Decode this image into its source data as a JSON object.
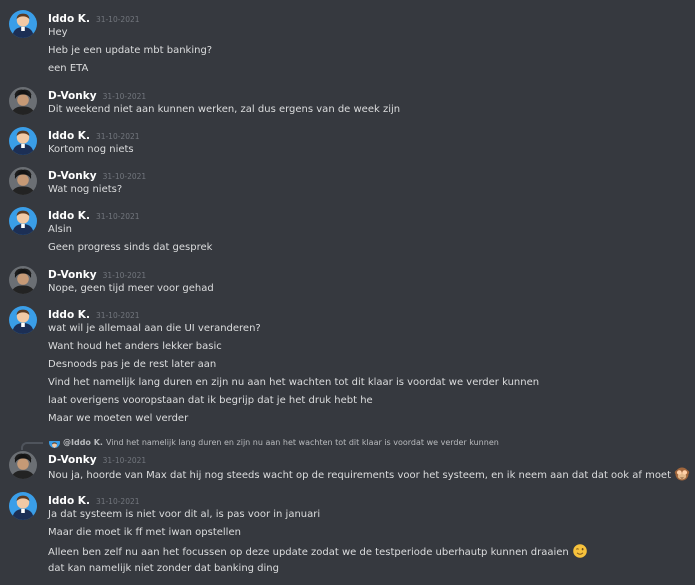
{
  "users": {
    "iddo": {
      "name": "Iddo K.",
      "reply_name": "@Iddo K."
    },
    "dvonky": {
      "name": "D-Vonky"
    }
  },
  "timestamp": "31-10-2021",
  "groups": [
    {
      "author": "Iddo K.",
      "time": "31-10-2021",
      "lines": [
        "Hey",
        "Heb je een update mbt banking?",
        "een ETA"
      ]
    },
    {
      "author": "D-Vonky",
      "time": "31-10-2021",
      "lines": [
        "Dit weekend niet aan kunnen werken, zal dus ergens van de week zijn"
      ]
    },
    {
      "author": "Iddo K.",
      "time": "31-10-2021",
      "lines": [
        "Kortom nog niets"
      ]
    },
    {
      "author": "D-Vonky",
      "time": "31-10-2021",
      "lines": [
        "Wat nog niets?"
      ]
    },
    {
      "author": "Iddo K.",
      "time": "31-10-2021",
      "lines": [
        "Alsin",
        "Geen progress sinds dat gesprek"
      ]
    },
    {
      "author": "D-Vonky",
      "time": "31-10-2021",
      "lines": [
        "Nope, geen tijd meer voor gehad"
      ]
    },
    {
      "author": "Iddo K.",
      "time": "31-10-2021",
      "lines": [
        "wat wil je allemaal aan die UI veranderen?",
        "Want houd het anders lekker basic",
        "Desnoods pas je de rest later aan",
        "Vind het namelijk lang duren en zijn nu aan het wachten tot dit klaar is voordat we verder kunnen",
        "laat overigens vooropstaan dat ik begrijp dat je het druk hebt he",
        "Maar we moeten wel verder"
      ]
    },
    {
      "author": "D-Vonky",
      "time": "31-10-2021",
      "lines": [
        "Nou ja, hoorde van Max dat hij nog steeds wacht op de requirements voor het systeem, en ik neem aan dat dat ook af moet"
      ]
    },
    {
      "author": "Iddo K.",
      "time": "31-10-2021",
      "lines": [
        "Ja dat systeem is niet voor dit al, is pas voor in januari",
        "Maar die moet ik ff met iwan opstellen",
        "Alleen ben zelf nu aan het focussen op deze update zodat we de testperiode uberhautp kunnen draaien",
        "dat kan namelijk niet zonder dat banking ding"
      ]
    }
  ],
  "reply": {
    "author": "@Iddo K.",
    "text": "Vind het namelijk lang duren en zijn nu aan het wachten tot dit klaar is voordat we verder kunnen"
  },
  "icons": {
    "iddo_avatar": "avatar-blue-person",
    "dvonky_avatar": "avatar-dark-person",
    "emoji_1": "see-no-evil-monkey",
    "emoji_2": "winking-face"
  },
  "colors": {
    "background": "#36393f",
    "author": "#ffffff",
    "text": "#dcddde",
    "muted": "#72767d",
    "iddo_avatar_bg": "#3a9ee8"
  }
}
